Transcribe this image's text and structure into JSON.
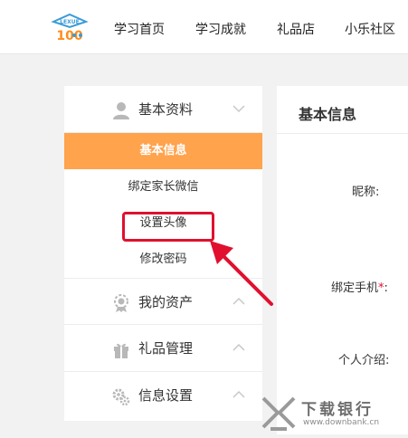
{
  "header": {
    "logo_text": "LEXUE 100",
    "nav": [
      {
        "label": "学习首页"
      },
      {
        "label": "学习成就"
      },
      {
        "label": "礼品店"
      },
      {
        "label": "小乐社区"
      }
    ]
  },
  "sidebar": {
    "sections": [
      {
        "label": "基本资料",
        "icon": "user-icon",
        "expanded": true
      },
      {
        "label": "我的资产",
        "icon": "badge-icon",
        "expanded": false
      },
      {
        "label": "礼品管理",
        "icon": "gift-icon",
        "expanded": false
      },
      {
        "label": "信息设置",
        "icon": "settings-icon",
        "expanded": false
      }
    ],
    "sub_items": [
      {
        "label": "基本信息",
        "active": true
      },
      {
        "label": "绑定家长微信",
        "active": false
      },
      {
        "label": "设置头像",
        "active": false,
        "highlighted": true
      },
      {
        "label": "修改密码",
        "active": false
      }
    ]
  },
  "content": {
    "title": "基本信息",
    "fields": [
      {
        "label": "昵称:"
      },
      {
        "label": "绑定手机",
        "required_mark": "*",
        "suffix": ":"
      },
      {
        "label": "个人介绍:"
      }
    ]
  },
  "watermark": {
    "title": "下载银行",
    "url": "www.downbank.cn"
  },
  "colors": {
    "accent": "#ffa34d",
    "highlight": "#e0102e"
  }
}
